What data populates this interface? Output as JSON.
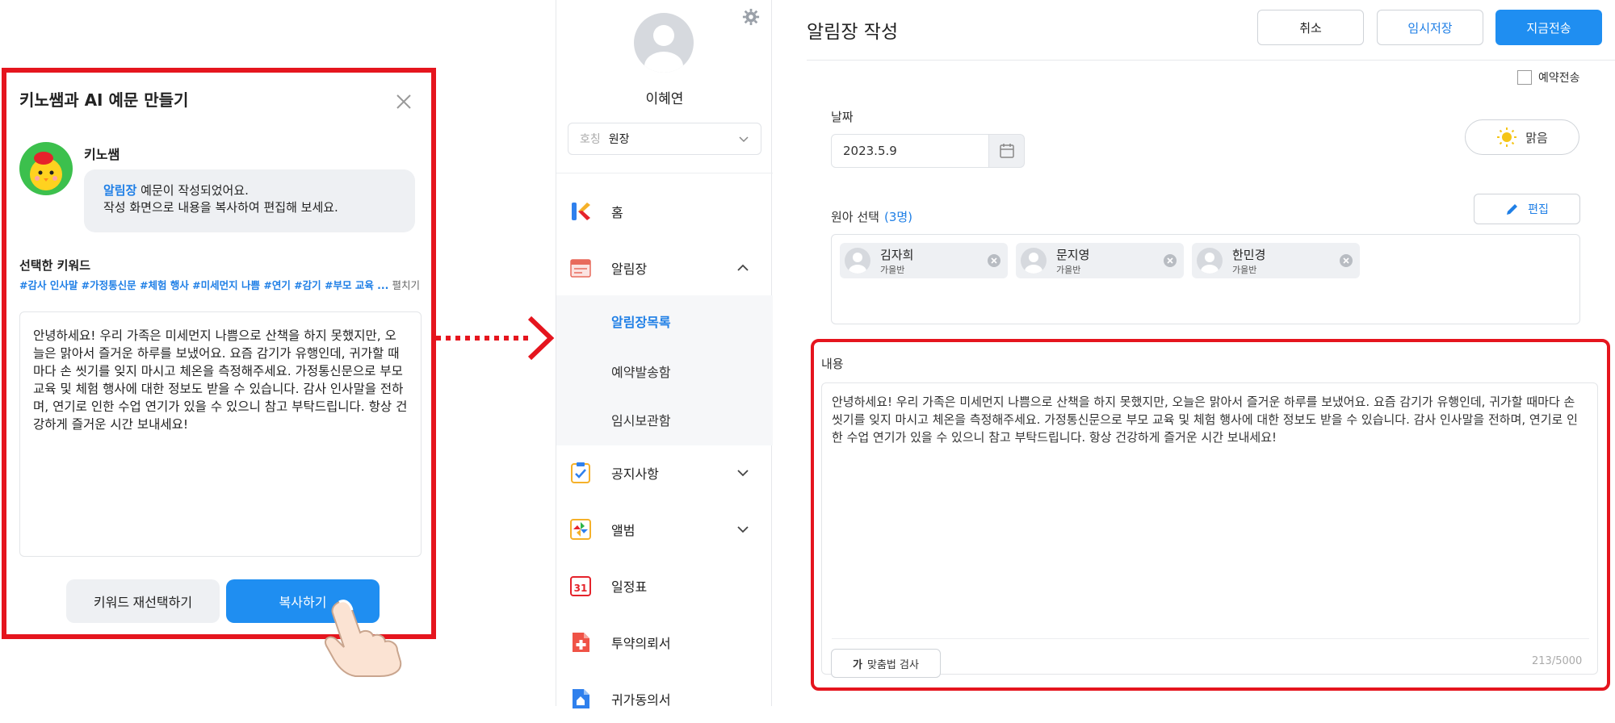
{
  "ai_dialog": {
    "title": "키노쌤과 AI 예문 만들기",
    "bot_name": "키노쌤",
    "message_highlight": "알림장",
    "message_line1": " 예문이 작성되었어요.",
    "message_line2": "작성 화면으로 내용을 복사하여 편집해 보세요.",
    "keywords_title": "선택한 키워드",
    "keywords": "#감사 인사말 #가정통신문 #체험 행사 #미세먼지 나쁨 #연기 #감기 #부모 교육 ...",
    "keywords_toggle": "펼치기",
    "generated_text": "안녕하세요! 우리 가족은 미세먼지 나쁨으로 산책을 하지 못했지만, 오늘은 맑아서 즐거운 하루를 보냈어요. 요즘 감기가 유행인데, 귀가할 때마다 손 씻기를 잊지 마시고 체온을 측정해주세요. 가정통신문으로 부모 교육 및 체험 행사에 대한 정보도 받을 수 있습니다. 감사 인사말을 전하며, 연기로 인한 수업 연기가 있을 수 있으니 참고 부탁드립니다. 항상 건강하게 즐거운 시간 보내세요!",
    "reselect_label": "키워드 재선택하기",
    "copy_label": "복사하기"
  },
  "sidebar": {
    "profile_name": "이혜연",
    "title_label": "호칭",
    "title_value": "원장",
    "nav": [
      {
        "label": "홈",
        "icon": "kinder-logo-icon"
      },
      {
        "label": "알림장",
        "icon": "notebook-icon"
      },
      {
        "label": "공지사항",
        "icon": "clipboard-check-icon"
      },
      {
        "label": "앨범",
        "icon": "pinwheel-icon"
      },
      {
        "label": "일정표",
        "icon": "calendar-31-icon",
        "icon_text": "31"
      },
      {
        "label": "투약의뢰서",
        "icon": "medical-doc-icon"
      },
      {
        "label": "귀가동의서",
        "icon": "home-doc-icon"
      }
    ],
    "submenu": [
      "알림장목록",
      "예약발송함",
      "임시보관함"
    ]
  },
  "main": {
    "title": "알림장 작성",
    "cancel_label": "취소",
    "temp_save_label": "임시저장",
    "send_now_label": "지금전송",
    "schedule_label": "예약전송",
    "date_label": "날짜",
    "date_value": "2023.5.9",
    "weather_label": "맑음",
    "kids_label": "원아 선택",
    "kids_count": "(3명)",
    "edit_label": "편집",
    "kids": [
      {
        "name": "김자희",
        "class": "가을반"
      },
      {
        "name": "문지영",
        "class": "가을반"
      },
      {
        "name": "한민경",
        "class": "가을반"
      }
    ],
    "content_label": "내용",
    "content_text": "안녕하세요! 우리 가족은 미세먼지 나쁨으로 산책을 하지 못했지만, 오늘은 맑아서 즐거운 하루를 보냈어요. 요즘 감기가 유행인데, 귀가할 때마다 손 씻기를 잊지 마시고 체온을 측정해주세요. 가정통신문으로 부모 교육 및 체험 행사에 대한 정보도 받을 수 있습니다. 감사 인사말을 전하며, 연기로 인한 수업 연기가 있을 수 있으니 참고 부탁드립니다. 항상 건강하게 즐거운 시간 보내세요!",
    "spellcheck_icon": "가",
    "spellcheck_label": "맞춤법 검사",
    "char_count": "213/5000"
  },
  "colors": {
    "accent": "#1f8ef1",
    "link": "#1f7fe6",
    "highlight_frame": "#e5151e"
  }
}
